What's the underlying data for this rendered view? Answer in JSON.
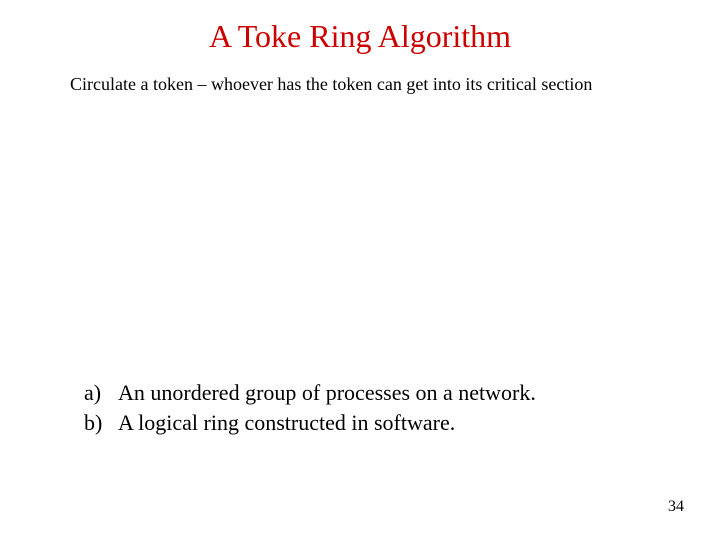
{
  "title": "A Toke Ring Algorithm",
  "subtext": "Circulate  a token – whoever has the token can get into its critical section",
  "list": {
    "items": [
      {
        "marker": "a)",
        "text": "An unordered group of processes on a network."
      },
      {
        "marker": "b)",
        "text": "A logical ring constructed in software."
      }
    ]
  },
  "page_number": "34"
}
